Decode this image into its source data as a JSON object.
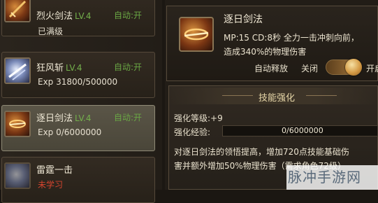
{
  "skills": [
    {
      "name": "烈火剑法",
      "level": "LV.4",
      "auto": "自动:开",
      "sub": "已满级"
    },
    {
      "name": "狂风斩",
      "level": "LV.4",
      "auto": "自动:开",
      "sub": "Exp 31800/500000"
    },
    {
      "name": "逐日剑法",
      "level": "LV.4",
      "auto": "自动:开",
      "sub": "Exp 0/6000000"
    },
    {
      "name": "雷霆一击",
      "sub": "未学习"
    }
  ],
  "detail": {
    "name": "逐日剑法",
    "desc_line1": "MP:15  CD:8秒  全力一击冲刺向前，",
    "desc_line2": "造成340%的物理伤害",
    "auto_release_label": "自动释放",
    "off_label": "关闭",
    "on_label": "开启",
    "auto_release_on": true
  },
  "enhance": {
    "title": "技能强化",
    "level_line": "强化等级:+9",
    "exp_label": "强化经验:",
    "exp_text": "0/6000000",
    "exp_fraction": 0.0,
    "desc_line1": "对逐日剑法的领悟提高，增加720点技能基础伤",
    "desc_line2": "害并额外增加50%物理伤害（需求角色72级）"
  },
  "watermark": "脉冲手游网",
  "colors": {
    "level_green": "#74b04c",
    "auto_green": "#6aa744",
    "unlearned_red": "#d4442e",
    "exp_fill": "#9c7a3a"
  }
}
